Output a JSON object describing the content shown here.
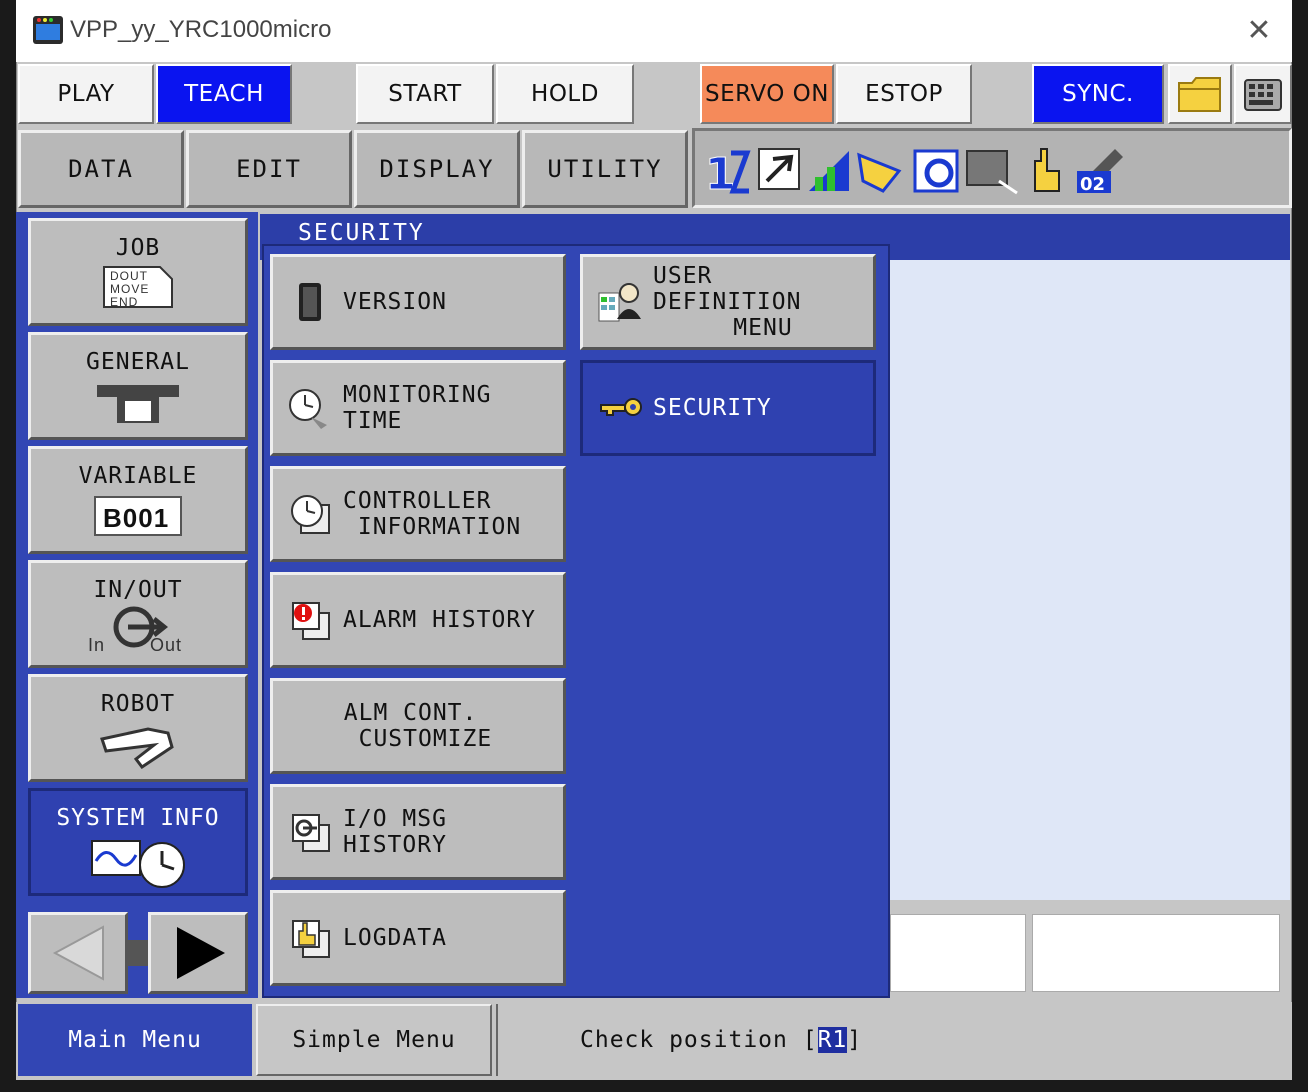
{
  "window": {
    "title": "VPP_yy_YRC1000micro"
  },
  "top_buttons": {
    "play": "PLAY",
    "teach": "TEACH",
    "start": "START",
    "hold": "HOLD",
    "servo_on": "SERVO ON",
    "estop": "ESTOP",
    "sync": "SYNC."
  },
  "menu_bar": {
    "data": "DATA",
    "edit": "EDIT",
    "display": "DISPLAY",
    "utility": "UTILITY"
  },
  "status_icons": [
    "coordinate-icon",
    "tool-icon",
    "speed-icon",
    "mode-icon",
    "cycle-icon",
    "screen-icon",
    "hand-icon",
    "manipulator-02-icon"
  ],
  "status_icon_text": {
    "manipulator": "02"
  },
  "left_menu": {
    "job": {
      "label": "JOB",
      "icon_lines": [
        "DOUT",
        "MOVE",
        "END"
      ]
    },
    "general": {
      "label": "GENERAL"
    },
    "variable": {
      "label": "VARIABLE",
      "icon_text": "B001"
    },
    "inout": {
      "label": "IN/OUT",
      "icon_in": "In",
      "icon_out": "Out"
    },
    "robot": {
      "label": "ROBOT"
    },
    "system_info": {
      "label": "SYSTEM INFO"
    }
  },
  "header": {
    "title": "SECURITY"
  },
  "submenu": {
    "version": "VERSION",
    "monitoring_time": "MONITORING TIME",
    "controller_info_1": "CONTROLLER",
    "controller_info_2": " INFORMATION",
    "alarm_history": "ALARM HISTORY",
    "alm_cont_1": "ALM CONT.",
    "alm_cont_2": " CUSTOMIZE",
    "io_msg_history": "I/O MSG HISTORY",
    "logdata": "LOGDATA",
    "user_def_1": "USER DEFINITION",
    "user_def_2": "MENU",
    "security": "SECURITY"
  },
  "bottom": {
    "main_menu": "Main Menu",
    "simple_menu": "Simple Menu",
    "status_prefix": "Check position [",
    "status_highlight": "R1",
    "status_suffix": "]"
  },
  "colors": {
    "panel_blue": "#3246b4",
    "teach_blue": "#0a14f0",
    "servo_orange": "#f58a5a"
  }
}
